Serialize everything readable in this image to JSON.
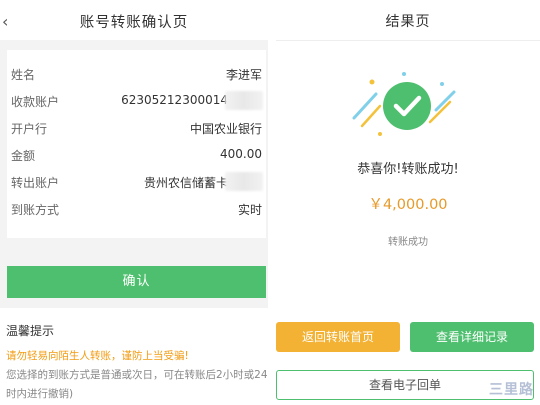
{
  "left": {
    "title": "账号转账确认页",
    "fields": [
      {
        "label": "姓名",
        "value": "李进军"
      },
      {
        "label": "收款账户",
        "value": "62305212300014"
      },
      {
        "label": "开户行",
        "value": "中国农业银行"
      },
      {
        "label": "金额",
        "value": "400.00"
      },
      {
        "label": "转出账户",
        "value": "贵州农信储蓄卡"
      },
      {
        "label": "到账方式",
        "value": "实时"
      }
    ],
    "confirm_label": "确认",
    "tips": {
      "title": "温馨提示",
      "warning": "请勿轻易向陌生人转账，谨防上当受骗!",
      "lines": [
        "您选择的到账方式是普通或次日，可在转账后2小时或24小",
        "时内进行撤销)"
      ]
    }
  },
  "right": {
    "title": "结果页",
    "success_text": "恭喜你!转账成功!",
    "amount": "￥4,000.00",
    "status": "转账成功",
    "home_button": "返回转账首页",
    "detail_button": "查看详细记录",
    "third_button": "查看电子回单",
    "watermark": "三里路"
  },
  "colors": {
    "green": "#4ebf6e",
    "orange": "#f3b234",
    "amount": "#e69a2a"
  }
}
